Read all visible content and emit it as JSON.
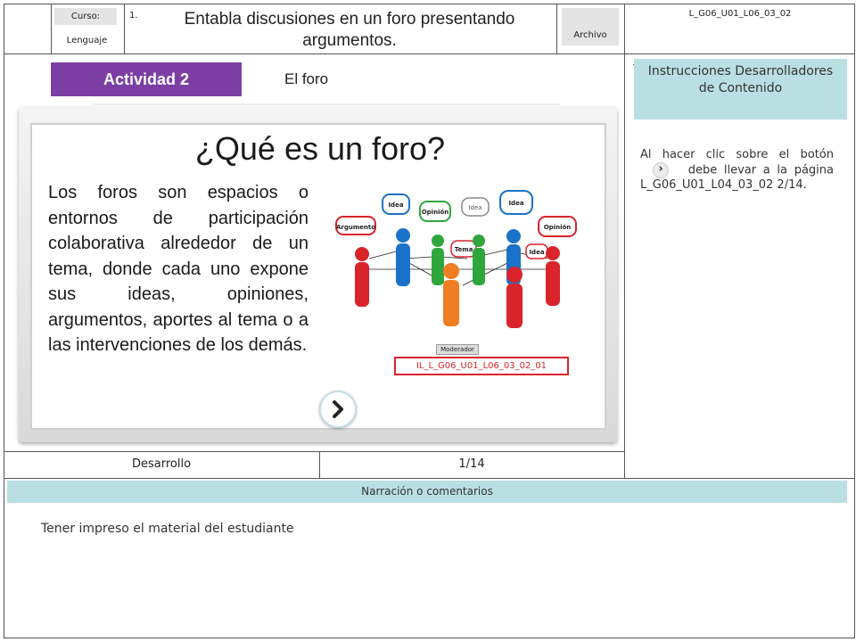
{
  "header": {
    "course_tag": "Curso:",
    "subject": "Lenguaje",
    "number": "1.",
    "title": "Entabla discusiones en un foro presentando argumentos.",
    "file_tag": "Archivo",
    "code": "L_G06_U01_L06_03_02"
  },
  "activity": {
    "badge": "Actividad 2",
    "name": "El foro"
  },
  "slide": {
    "heading": "¿Qué es un foro?",
    "body": "Los foros son espacios o entornos de participación colaborativa alrededor de un tema, donde cada uno expone sus ideas, opiniones, argumentos, aportes al tema o a las intervenciones de los demás.",
    "image_id": "IL_L_G06_U01_L06_03_02_01",
    "image_labels": [
      "Argumento",
      "Idea",
      "Opinión",
      "Idea",
      "Idea",
      "Opinión",
      "Tema",
      "Idea",
      "Moderador"
    ],
    "next_icon": "chevron-right-icon"
  },
  "footer_row": {
    "section": "Desarrollo",
    "page": "1/14"
  },
  "instructions": {
    "title": "Instrucciones Desarrolladores de Contenido",
    "text_before": "Al hacer clic sobre el botón",
    "text_after": "debe llevar a la página L_G06_U01_L04_03_02 2/14."
  },
  "narration": {
    "title": "Narración o comentarios",
    "text": "Tener impreso el material del estudiante"
  },
  "colors": {
    "badge": "#7b3fa4",
    "teal": "#b9dfe3",
    "red_label": "#d9242b"
  }
}
